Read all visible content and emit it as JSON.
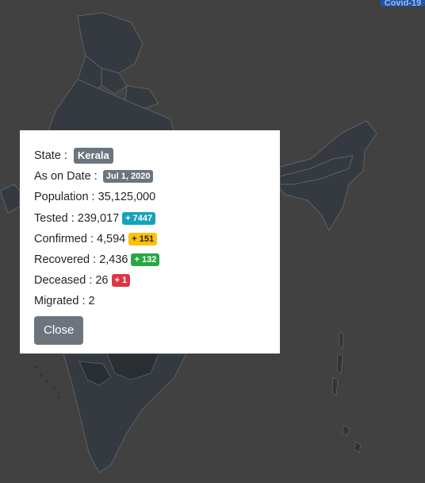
{
  "corner_button": {
    "label": "Covid-19"
  },
  "modal": {
    "state_label": "State :",
    "state_value": "Kerala",
    "date_label": "As on Date :",
    "date_value": "Jul 1, 2020",
    "population_label": "Population :",
    "population_value": "35,125,000",
    "tested_label": "Tested :",
    "tested_value": "239,017",
    "tested_delta": "+ 7447",
    "confirmed_label": "Confirmed :",
    "confirmed_value": "4,594",
    "confirmed_delta": "+ 151",
    "recovered_label": "Recovered :",
    "recovered_value": "2,436",
    "recovered_delta": "+ 132",
    "deceased_label": "Deceased :",
    "deceased_value": "26",
    "deceased_delta": "+ 1",
    "migrated_label": "Migrated :",
    "migrated_value": "2",
    "close_label": "Close"
  },
  "colors": {
    "overlay": "#414141",
    "map_fill": "#343a40",
    "map_stroke": "#5c6166",
    "tested_badge": "#17a2b8",
    "confirmed_badge": "#ffc107",
    "recovered_badge": "#28a745",
    "deceased_badge": "#dc3545",
    "neutral_badge": "#6c757d"
  }
}
